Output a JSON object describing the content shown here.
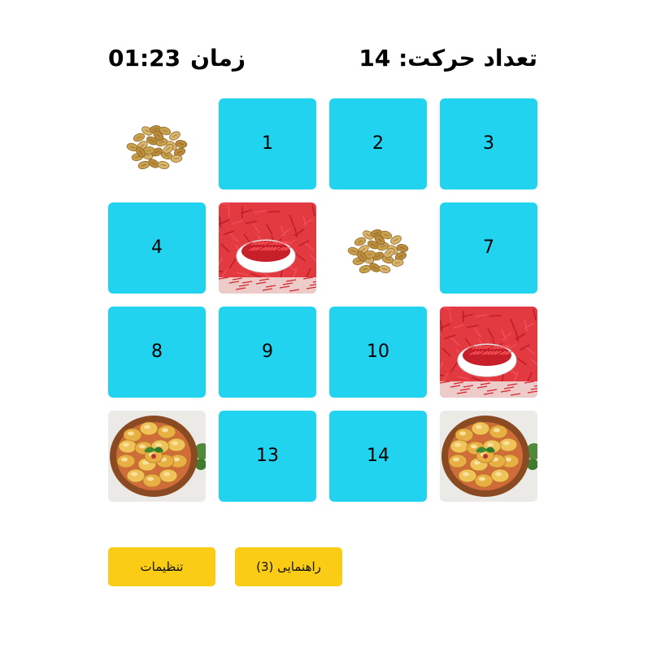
{
  "header": {
    "timer_label": "زمان",
    "timer_value": "01:23",
    "moves_label": "تعداد حرکت:",
    "moves_value": "14"
  },
  "colors": {
    "hidden_card": "#21d3ee",
    "button": "#facc15"
  },
  "cards": [
    {
      "state": "revealed",
      "image": "pistachio-image"
    },
    {
      "state": "hidden",
      "label": "1"
    },
    {
      "state": "hidden",
      "label": "2"
    },
    {
      "state": "hidden",
      "label": "3"
    },
    {
      "state": "hidden",
      "label": "4"
    },
    {
      "state": "revealed",
      "image": "saffron-image"
    },
    {
      "state": "revealed",
      "image": "pistachio-image"
    },
    {
      "state": "hidden",
      "label": "7"
    },
    {
      "state": "hidden",
      "label": "8"
    },
    {
      "state": "hidden",
      "label": "9"
    },
    {
      "state": "hidden",
      "label": "10"
    },
    {
      "state": "revealed",
      "image": "saffron-image"
    },
    {
      "state": "revealed",
      "image": "pastry-image"
    },
    {
      "state": "hidden",
      "label": "13"
    },
    {
      "state": "hidden",
      "label": "14"
    },
    {
      "state": "revealed",
      "image": "pastry-image"
    }
  ],
  "buttons": {
    "settings_label": "تنظیمات",
    "hint_label": "راهنمایی (3)"
  }
}
